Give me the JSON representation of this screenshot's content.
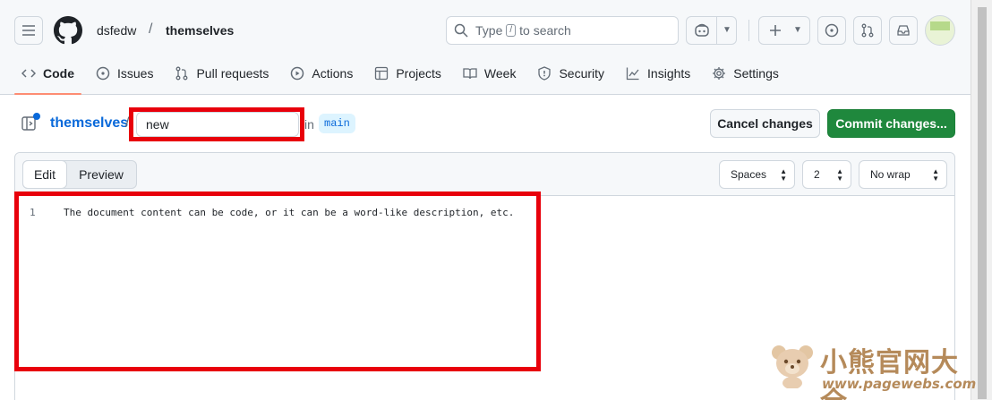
{
  "header": {
    "owner": "dsfedw",
    "separator": "/",
    "repo": "themselves",
    "search": {
      "prefix": "Type",
      "key": "/",
      "suffix": "to search"
    }
  },
  "tabs": [
    {
      "label": "Code",
      "icon": "code-icon",
      "active": true
    },
    {
      "label": "Issues",
      "icon": "issue-icon"
    },
    {
      "label": "Pull requests",
      "icon": "pull-request-icon"
    },
    {
      "label": "Actions",
      "icon": "play-icon"
    },
    {
      "label": "Projects",
      "icon": "table-icon"
    },
    {
      "label": "Week",
      "icon": "book-icon"
    },
    {
      "label": "Security",
      "icon": "shield-icon"
    },
    {
      "label": "Insights",
      "icon": "graph-icon"
    },
    {
      "label": "Settings",
      "icon": "gear-icon"
    }
  ],
  "file": {
    "repo_link": "themselves",
    "separator": "/",
    "name_value": "new",
    "in_label": "in",
    "branch": "main"
  },
  "actions": {
    "cancel": "Cancel changes",
    "commit": "Commit changes..."
  },
  "editor": {
    "mode_edit": "Edit",
    "mode_preview": "Preview",
    "indent_mode": "Spaces",
    "indent_size": "2",
    "wrap_mode": "No wrap",
    "lines": [
      {
        "number": "1",
        "text": "The document content can be code, or it can be a word-like description, etc."
      }
    ]
  },
  "watermark": {
    "title": "小熊官网大全",
    "url": "www.pagewebs.com"
  },
  "colors": {
    "accent": "#0969da",
    "commit_green": "#1f883d",
    "highlight_red": "#e8000b",
    "active_tab_underline": "#fd8c73"
  }
}
